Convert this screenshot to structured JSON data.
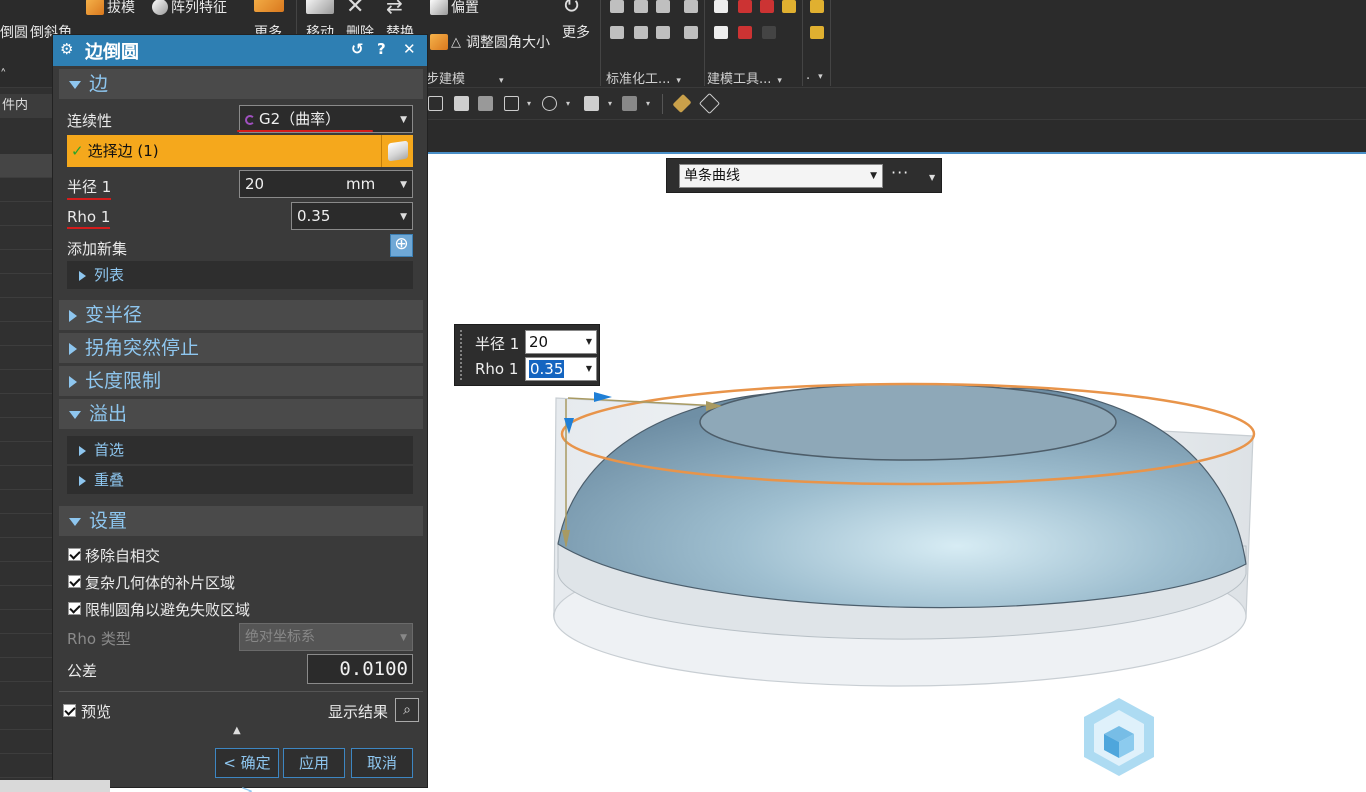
{
  "ribbon": {
    "row1": [
      "倒圆",
      "倒斜角",
      "拔模",
      "阵列特征",
      "更多",
      "移动",
      "删除",
      "替换",
      "偏置"
    ],
    "row2": [
      "调整圆角大小",
      "更多"
    ],
    "left_stub": "件内",
    "groups": [
      "步建模",
      "标准化工...",
      "建模工具..."
    ],
    "group_dots": "."
  },
  "filter": {
    "value": "单条曲线",
    "more": "···"
  },
  "float_box": {
    "radius_label": "半径 1",
    "radius_value": "20",
    "rho_label": "Rho 1",
    "rho_value": "0.35"
  },
  "dialog": {
    "title": "边倒圆",
    "title_buttons": {
      "reset": "↺",
      "help": "?",
      "close": "✕"
    },
    "sections": {
      "edge": "边",
      "variable_radius": "变半径",
      "corner_setback": "拐角突然停止",
      "length_limit": "长度限制",
      "overflow": "溢出",
      "settings": "设置"
    },
    "edge": {
      "continuity_label": "连续性",
      "continuity_value": "G2（曲率）",
      "select_edge": "选择边 (1)",
      "radius_label": "半径 1",
      "radius_value": "20",
      "radius_unit": "mm",
      "rho_label": "Rho 1",
      "rho_value": "0.35",
      "add_set": "添加新集",
      "list": "列表"
    },
    "overflow": {
      "preferred": "首选",
      "overlap": "重叠"
    },
    "settings": {
      "remove_self_intersect": "移除自相交",
      "complex_patch": "复杂几何体的补片区域",
      "limit_fillet": "限制圆角以避免失败区域",
      "rho_type_label": "Rho 类型",
      "rho_type_value": "绝对坐标系",
      "tolerance_label": "公差",
      "tolerance_value": "0.0100"
    },
    "preview": "预览",
    "show_result": "显示结果",
    "buttons": {
      "ok": "< 确定 >",
      "apply": "应用",
      "cancel": "取消"
    }
  },
  "colors": {
    "title_bar": "#2e7fb3",
    "select_highlight": "#f5a81c",
    "section_text": "#8ec6ef",
    "edge_highlight": "#e8944a",
    "annotation_red": "#d41c1c"
  }
}
